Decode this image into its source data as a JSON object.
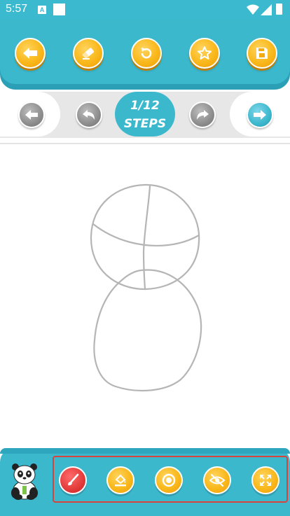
{
  "status_bar": {
    "time": "5:57",
    "notification_icon_letter": "A"
  },
  "top_toolbar": {
    "buttons": [
      {
        "name": "back",
        "icon": "arrow-left-icon"
      },
      {
        "name": "eraser",
        "icon": "eraser-icon"
      },
      {
        "name": "reset",
        "icon": "rotate-icon"
      },
      {
        "name": "favorite",
        "icon": "star-icon"
      },
      {
        "name": "save",
        "icon": "floppy-disk-icon"
      }
    ]
  },
  "step_nav": {
    "step_number": "1/12",
    "step_label": "STEPS",
    "buttons": [
      {
        "name": "previous-step",
        "icon": "arrow-left-icon",
        "state": "disabled"
      },
      {
        "name": "undo",
        "icon": "undo-icon",
        "state": "disabled"
      },
      {
        "name": "redo",
        "icon": "redo-icon",
        "state": "disabled"
      },
      {
        "name": "next-step",
        "icon": "arrow-right-icon",
        "state": "active"
      }
    ]
  },
  "drawing": {
    "subject": "panda",
    "stroke_color": "#b5b5b5"
  },
  "bottom_toolbar": {
    "tools": [
      {
        "name": "brush",
        "icon": "brush-icon",
        "selected": true
      },
      {
        "name": "fill",
        "icon": "paint-bucket-icon",
        "selected": false
      },
      {
        "name": "stroke-size",
        "icon": "circle-target-icon",
        "selected": false
      },
      {
        "name": "hide-guide",
        "icon": "eye-off-icon",
        "selected": false
      },
      {
        "name": "fullscreen",
        "icon": "expand-icon",
        "selected": false
      }
    ]
  },
  "colors": {
    "primary": "#3cb8cd",
    "accent": "#f9b81b",
    "selected_tool": "#e33a3a",
    "highlight_frame": "#d9433d"
  }
}
